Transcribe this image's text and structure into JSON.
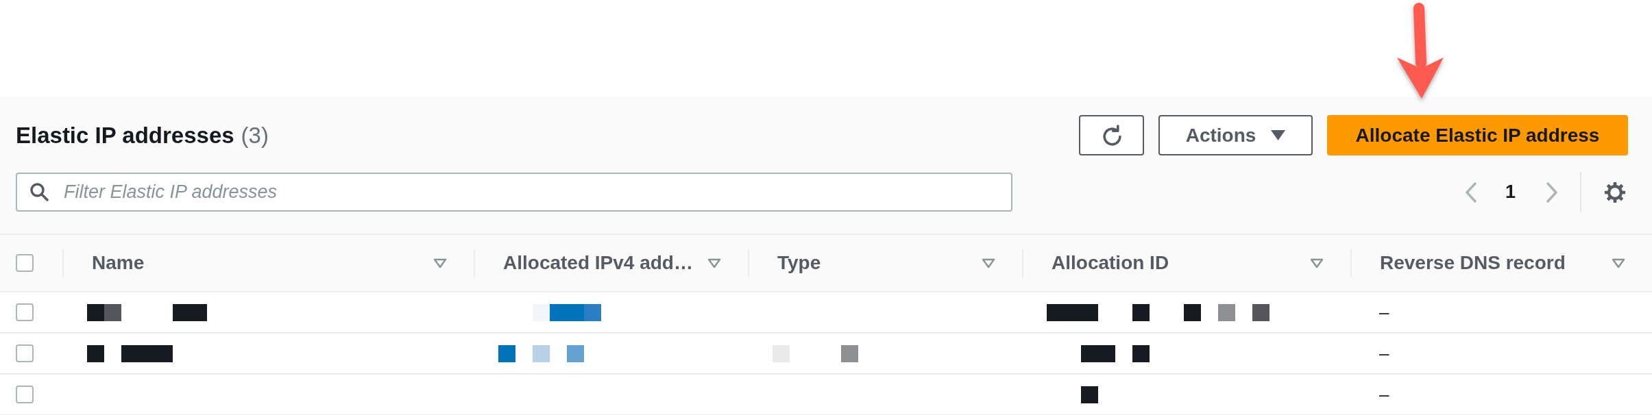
{
  "page": {
    "title": "Elastic IP addresses",
    "count": "(3)"
  },
  "toolbar": [
    {
      "kind": "refresh"
    },
    {
      "kind": "dropdown",
      "label": "Actions"
    },
    {
      "kind": "primary",
      "label": "Allocate Elastic IP address"
    }
  ],
  "search": {
    "placeholder": "Filter Elastic IP addresses"
  },
  "pagination": {
    "previous_disabled": true,
    "page": "1",
    "next_disabled": true
  },
  "table": {
    "select_all": {
      "checked": false
    },
    "columns": [
      "Name",
      "Allocated IPv4 add…",
      "Type",
      "Allocation ID",
      "Reverse DNS record"
    ],
    "rows": [
      {
        "selected": false,
        "cells": [
          {
            "kind": "mosaic",
            "tiles": [
              {
                "kind": "tile",
                "color": "#161b22"
              },
              {
                "kind": "tile",
                "color": "#54565c"
              },
              {
                "kind": "gap"
              },
              {
                "kind": "gap"
              },
              {
                "kind": "gap"
              },
              {
                "kind": "tile",
                "color": "#161b22"
              },
              {
                "kind": "tile",
                "color": "#161b22"
              }
            ]
          },
          {
            "kind": "mosaic",
            "tiles": [
              {
                "kind": "gap"
              },
              {
                "kind": "gap"
              },
              {
                "kind": "tile",
                "color": "#f2f6fa"
              },
              {
                "kind": "tile",
                "color": "#0073bb"
              },
              {
                "kind": "tile",
                "color": "#0073bb"
              },
              {
                "kind": "tile",
                "color": "#2a7fc4"
              }
            ]
          },
          {
            "kind": "empty"
          },
          {
            "kind": "mosaic",
            "tiles": [
              {
                "kind": "tile",
                "color": "#161b22"
              },
              {
                "kind": "tile",
                "color": "#161b22"
              },
              {
                "kind": "tile",
                "color": "#161b22"
              },
              {
                "kind": "gap"
              },
              {
                "kind": "gap"
              },
              {
                "kind": "tile",
                "color": "#161b22"
              },
              {
                "kind": "gap"
              },
              {
                "kind": "gap"
              },
              {
                "kind": "tile",
                "color": "#161b22"
              },
              {
                "kind": "gap"
              },
              {
                "kind": "tile",
                "color": "#8f9094"
              },
              {
                "kind": "gap"
              },
              {
                "kind": "tile",
                "color": "#54565c"
              }
            ]
          },
          {
            "kind": "text",
            "text": "–"
          }
        ]
      },
      {
        "selected": false,
        "cells": [
          {
            "kind": "mosaic",
            "tiles": [
              {
                "kind": "tile",
                "color": "#161b22"
              },
              {
                "kind": "gap"
              },
              {
                "kind": "tile",
                "color": "#161b22"
              },
              {
                "kind": "tile",
                "color": "#161b22"
              },
              {
                "kind": "tile",
                "color": "#161b22"
              }
            ]
          },
          {
            "kind": "mosaic",
            "tiles": [
              {
                "kind": "tile",
                "color": "#0073bb"
              },
              {
                "kind": "gap"
              },
              {
                "kind": "tile",
                "color": "#b8d1e8"
              },
              {
                "kind": "gap"
              },
              {
                "kind": "tile",
                "color": "#64a2d4"
              }
            ]
          },
          {
            "kind": "mosaic",
            "tiles": [
              {
                "kind": "tile",
                "color": "#e9e9ea"
              },
              {
                "kind": "gap"
              },
              {
                "kind": "gap"
              },
              {
                "kind": "gap"
              },
              {
                "kind": "tile",
                "color": "#8f9094"
              }
            ]
          },
          {
            "kind": "mosaic",
            "tiles": [
              {
                "kind": "gap"
              },
              {
                "kind": "gap"
              },
              {
                "kind": "tile",
                "color": "#161b22"
              },
              {
                "kind": "tile",
                "color": "#161b22"
              },
              {
                "kind": "gap"
              },
              {
                "kind": "tile",
                "color": "#161b22"
              }
            ]
          },
          {
            "kind": "text",
            "text": "–"
          }
        ]
      },
      {
        "selected": false,
        "cells": [
          {
            "kind": "empty"
          },
          {
            "kind": "empty"
          },
          {
            "kind": "empty"
          },
          {
            "kind": "mosaic",
            "tiles": [
              {
                "kind": "gap"
              },
              {
                "kind": "gap"
              },
              {
                "kind": "tile",
                "color": "#161b22"
              }
            ]
          },
          {
            "kind": "text",
            "text": "–"
          }
        ]
      }
    ]
  }
}
